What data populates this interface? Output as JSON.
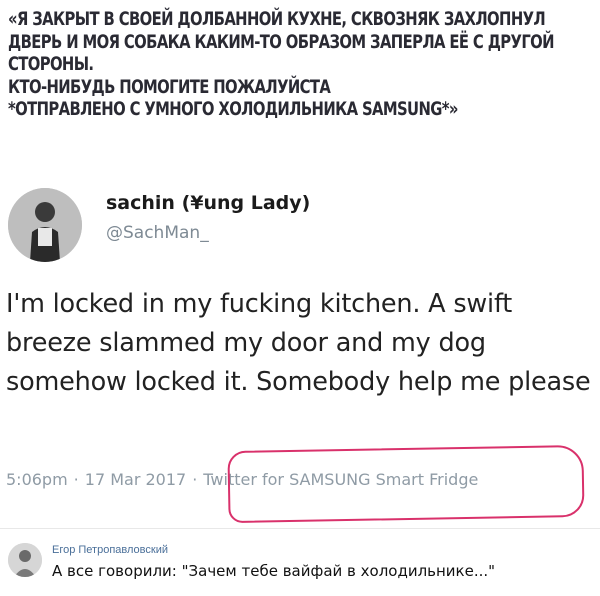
{
  "caption": {
    "lines": [
      "«Я ЗАКРЫТ В СВОЕЙ ДОЛБАННОЙ КУХНЕ, СКВОЗНЯК ЗАХЛОПНУЛ",
      "ДВЕРЬ И МОЯ СОБАКА КАКИМ-ТО ОБРАЗОМ ЗАПЕРЛА ЕЁ С ДРУГОЙ",
      "СТОРОНЫ.",
      "КТО-НИБУДЬ ПОМОГИТЕ ПОЖАЛУЙСТА",
      "*ОТПРАВЛЕНО С УМНОГО ХОЛОДИЛЬНИКА SAMSUNG*»"
    ]
  },
  "tweet": {
    "display_name": "sachin (¥ung Lady)",
    "handle": "@SachMan_",
    "text": "I'm locked in my fucking kitchen. A swift breeze slammed my door and my dog somehow locked it. Somebody help me please",
    "time": "5:06pm",
    "separator": "·",
    "date": "17 Mar 2017",
    "source": "Twitter for SAMSUNG Smart Fridge",
    "highlight_color": "#d9316b"
  },
  "comment": {
    "author": "Егор Петропавловский",
    "text": "А все говорили: \"Зачем тебе вайфай в холодильнике...\""
  }
}
